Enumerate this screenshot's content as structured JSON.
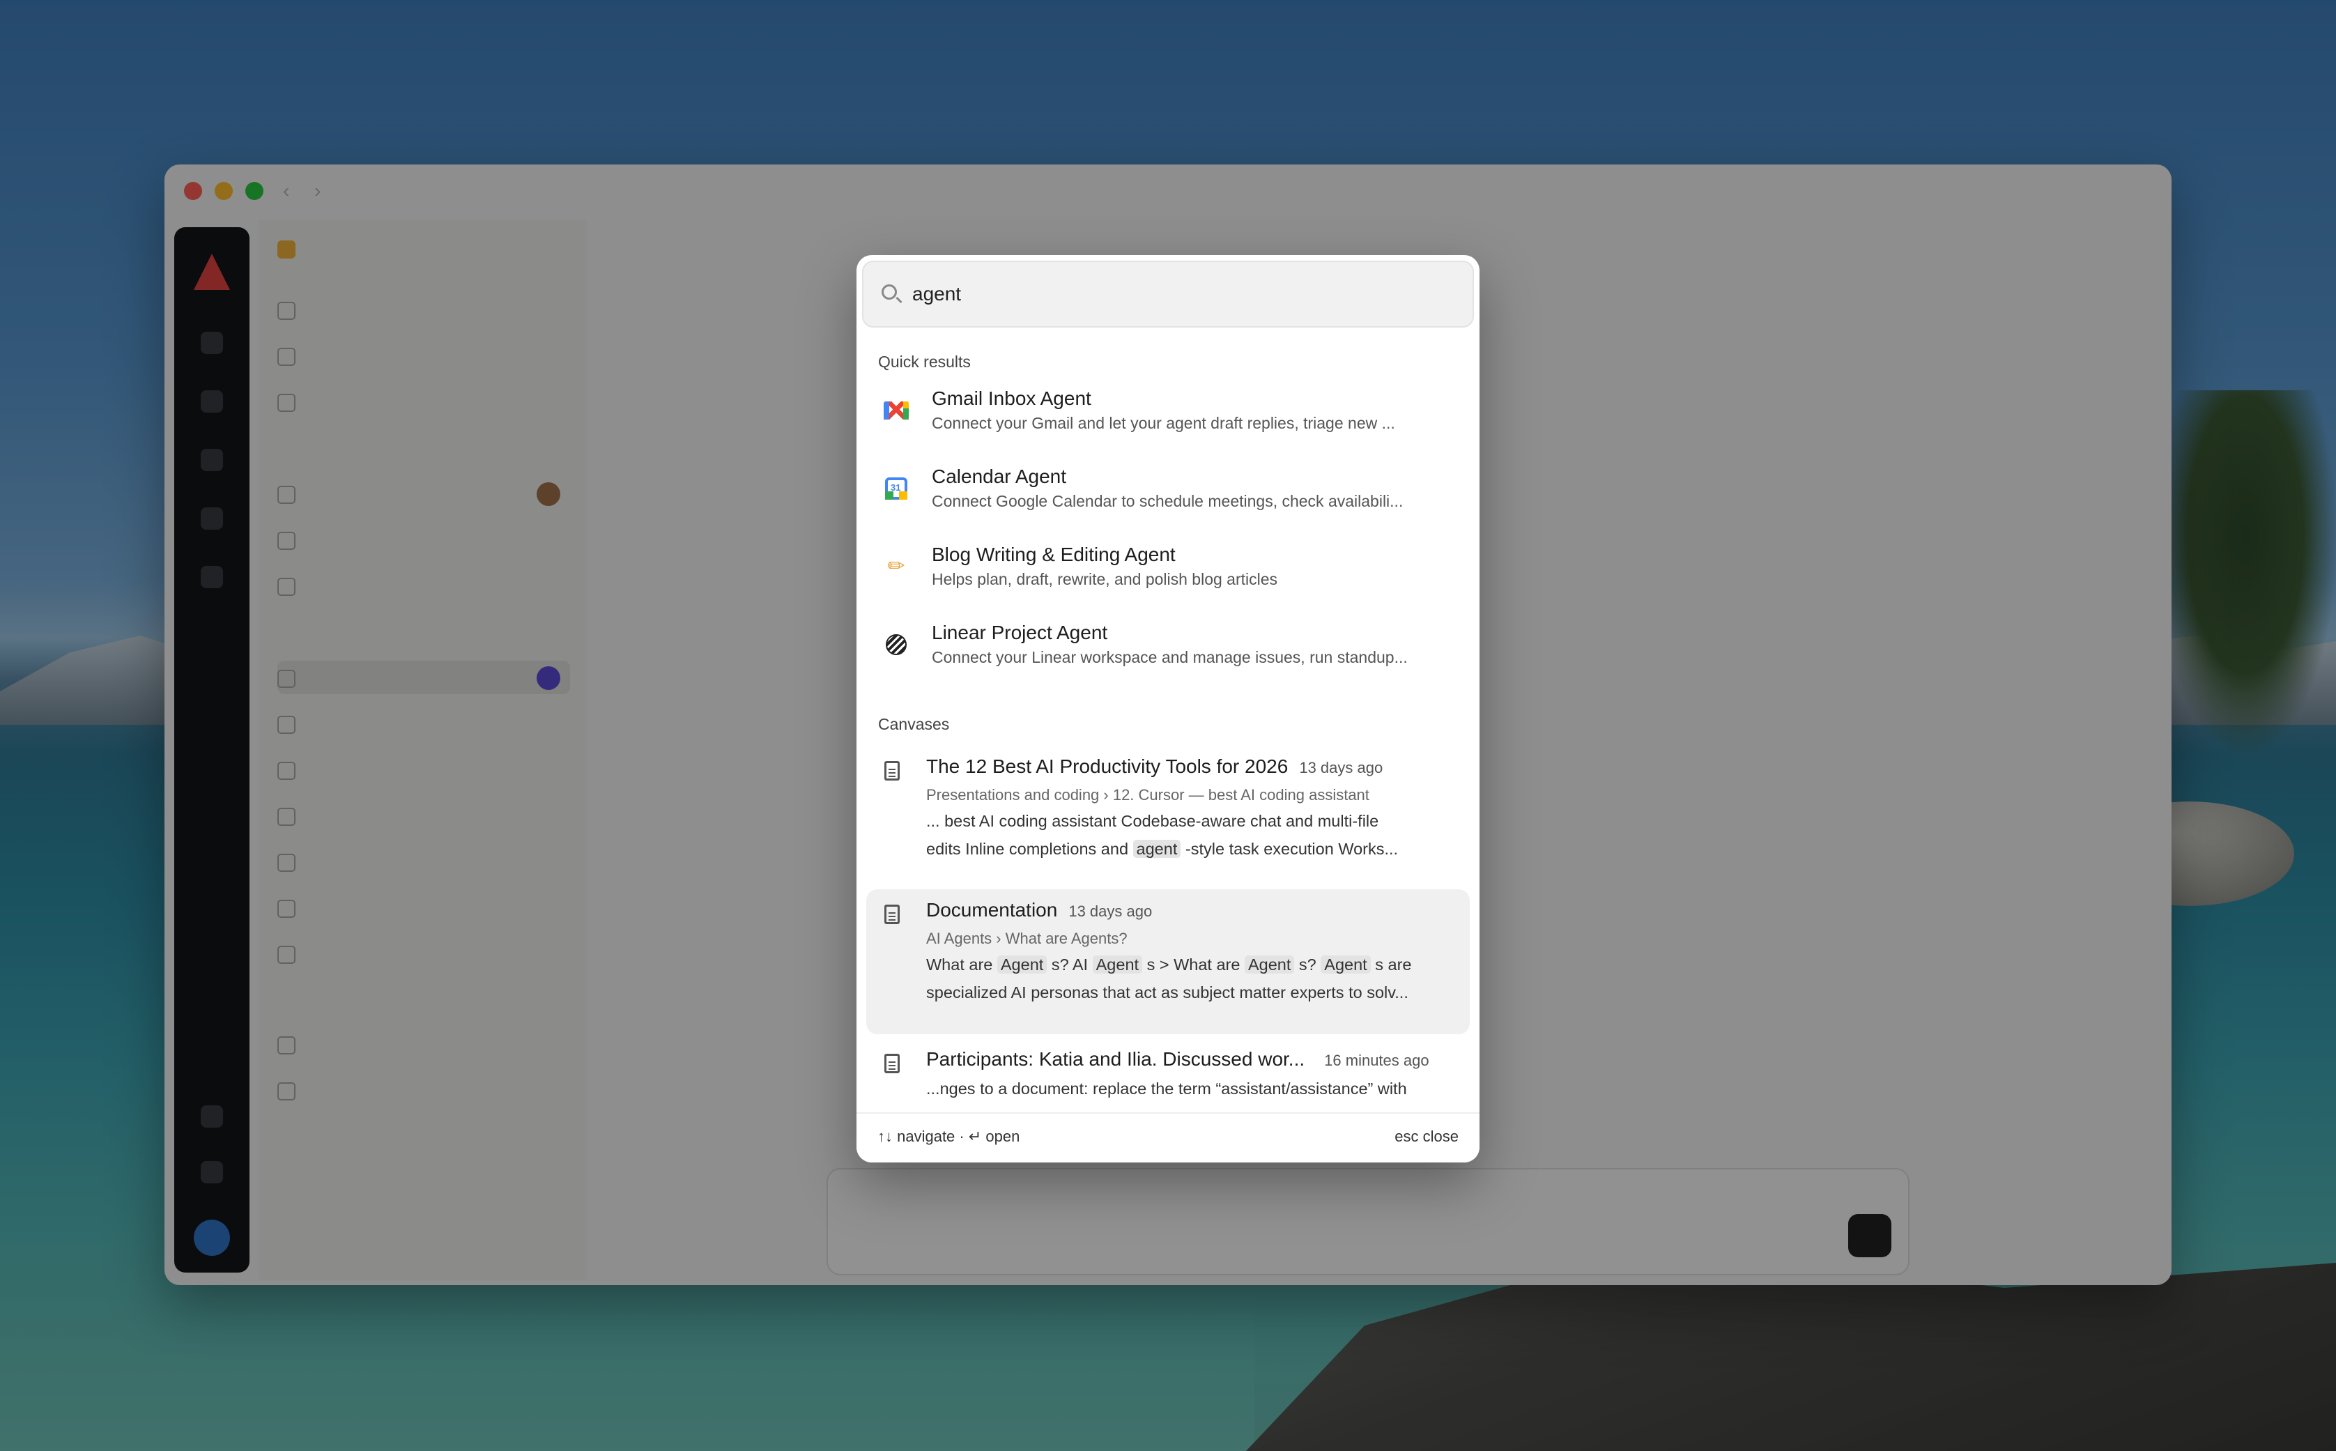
{
  "search": {
    "query": "agent"
  },
  "quick_results": {
    "label": "Quick results",
    "items": [
      {
        "title": "Gmail Inbox Agent",
        "description": "Connect your Gmail and let your agent draft replies, triage new ...",
        "icon": "gmail-icon"
      },
      {
        "title": "Calendar Agent",
        "description": "Connect Google Calendar to schedule meetings, check availabili...",
        "icon": "calendar-icon"
      },
      {
        "title": "Blog Writing & Editing Agent",
        "description": "Helps plan, draft, rewrite, and polish blog articles",
        "icon": "pencil-icon"
      },
      {
        "title": "Linear Project Agent",
        "description": "Connect your Linear workspace and manage issues, run standup...",
        "icon": "linear-icon"
      }
    ]
  },
  "canvases": {
    "label": "Canvases",
    "items": [
      {
        "title": "The 12 Best AI Productivity Tools for 2026",
        "time": "13 days ago",
        "path": "Presentations and coding › 12. Cursor — best AI coding assistant",
        "line1": "... best AI coding assistant Codebase-aware chat and multi-file",
        "line2_pre": "edits Inline completions and ",
        "line2_hl": "agent",
        "line2_post": " -style task execution Works..."
      },
      {
        "title": "Documentation",
        "time": "13 days ago",
        "path": "AI Agents › What are Agents?",
        "line1_parts": [
          "What are ",
          "Agent",
          " s? AI ",
          "Agent",
          " s > What are ",
          "Agent",
          " s? ",
          "Agent",
          " s are"
        ],
        "line2": "specialized AI personas that act as subject matter experts to solv..."
      },
      {
        "title": "Participants: Katia and Ilia. Discussed wor...",
        "time": "16 minutes ago",
        "line1": "...nges to a document: replace the term “assistant/assistance” with"
      }
    ]
  },
  "footer": {
    "left": "↑↓ navigate · ↵ open",
    "right": "esc close"
  },
  "colors": {
    "accent": "#2f74c7",
    "highlight": "#e3e3e3"
  }
}
